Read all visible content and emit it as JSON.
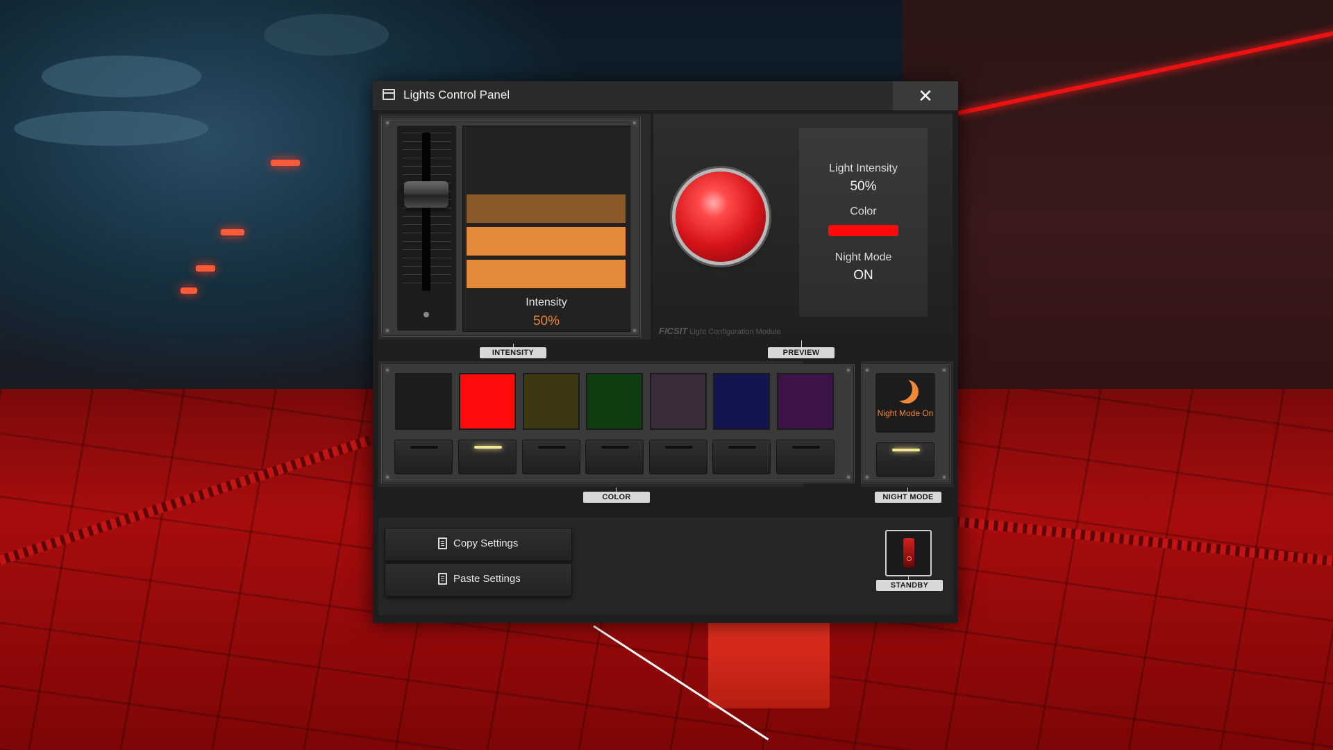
{
  "window": {
    "title": "Lights Control Panel",
    "close_label": "✕"
  },
  "intensity": {
    "label": "Intensity",
    "value": "50%",
    "level": 0.5,
    "tag": "INTENSITY",
    "bar_colors": [
      "#8a5a2c",
      "#e5893a",
      "#e5893a"
    ]
  },
  "preview": {
    "tag": "PREVIEW",
    "light_intensity_label": "Light Intensity",
    "light_intensity_value": "50%",
    "color_label": "Color",
    "color_value": "#ff0a0a",
    "night_mode_label": "Night Mode",
    "night_mode_value": "ON",
    "brand": "FICSIT",
    "module": "Light Configuration Module"
  },
  "color": {
    "tag": "COLOR",
    "swatches": [
      "#1c1c1c",
      "#ff0b0b",
      "#3d3712",
      "#0f3d12",
      "#3a2c3a",
      "#121650",
      "#3d1447"
    ],
    "selected_index": 1
  },
  "night_mode": {
    "tag": "NIGHT MODE",
    "text": "Night Mode On",
    "on": true
  },
  "actions": {
    "copy_label": "Copy Settings",
    "paste_label": "Paste Settings"
  },
  "standby": {
    "tag": "STANDBY"
  },
  "colors": {
    "accent": "#e8893a",
    "panel": "#1e1e1e"
  }
}
